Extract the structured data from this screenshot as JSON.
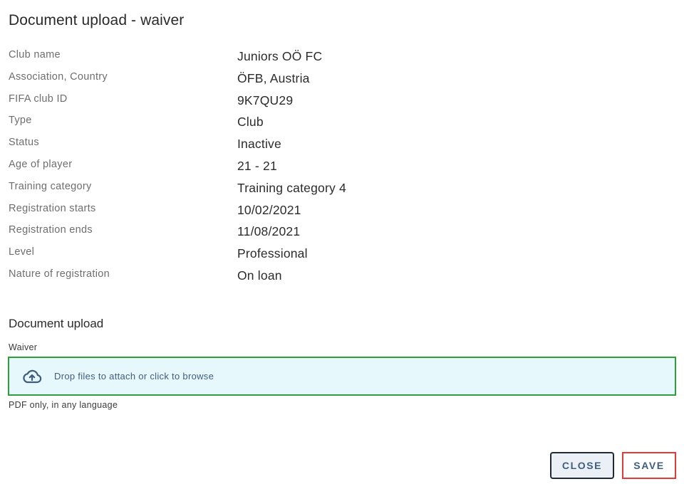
{
  "dialog": {
    "title": "Document upload - waiver"
  },
  "info": [
    {
      "label": "Club name",
      "value": "Juniors OÖ FC"
    },
    {
      "label": "Association, Country",
      "value": "ÖFB, Austria"
    },
    {
      "label": "FIFA club ID",
      "value": "9K7QU29"
    },
    {
      "label": "Type",
      "value": "Club"
    },
    {
      "label": "Status",
      "value": "Inactive"
    },
    {
      "label": "Age of player",
      "value": "21 - 21"
    },
    {
      "label": "Training category",
      "value": "Training category 4"
    },
    {
      "label": "Registration starts",
      "value": "10/02/2021"
    },
    {
      "label": "Registration ends",
      "value": "11/08/2021"
    },
    {
      "label": "Level",
      "value": "Professional"
    },
    {
      "label": "Nature of registration",
      "value": "On loan"
    }
  ],
  "upload": {
    "section_title": "Document upload",
    "field_label": "Waiver",
    "dropzone_text": "Drop files to attach or click to browse",
    "dropzone_icon": "cloud-upload-icon",
    "helper_text": "PDF only, in any language"
  },
  "actions": {
    "close_label": "CLOSE",
    "save_label": "SAVE"
  },
  "colors": {
    "accent": "#3f5d7d",
    "dropzone_bg": "#e7f8fc",
    "dropzone_border": "#2e9e3a",
    "save_border": "#e53935"
  }
}
